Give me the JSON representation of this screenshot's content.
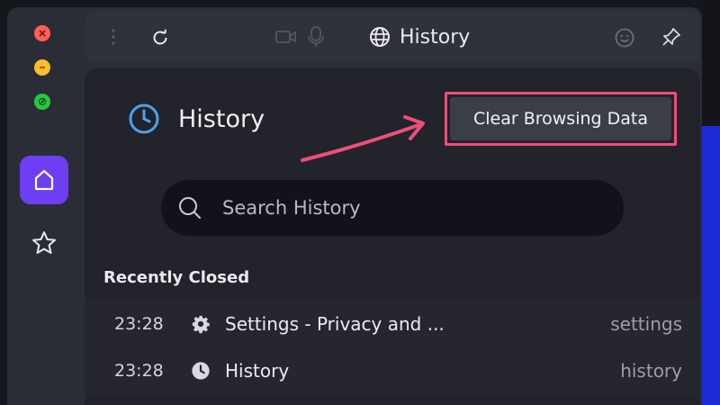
{
  "toolbar": {
    "title": "History"
  },
  "page": {
    "title": "History",
    "clear_button": "Clear Browsing Data"
  },
  "search": {
    "placeholder": "Search History"
  },
  "recently_closed": {
    "label": "Recently Closed",
    "items": [
      {
        "time": "23:28",
        "title": "Settings - Privacy and ...",
        "source": "settings",
        "icon": "gear-icon"
      },
      {
        "time": "23:28",
        "title": "History",
        "source": "history",
        "icon": "clock-icon"
      }
    ]
  },
  "colors": {
    "accent": "#6d3ef2",
    "annotation": "#ef4e7a",
    "history_icon": "#4aa3f0"
  }
}
